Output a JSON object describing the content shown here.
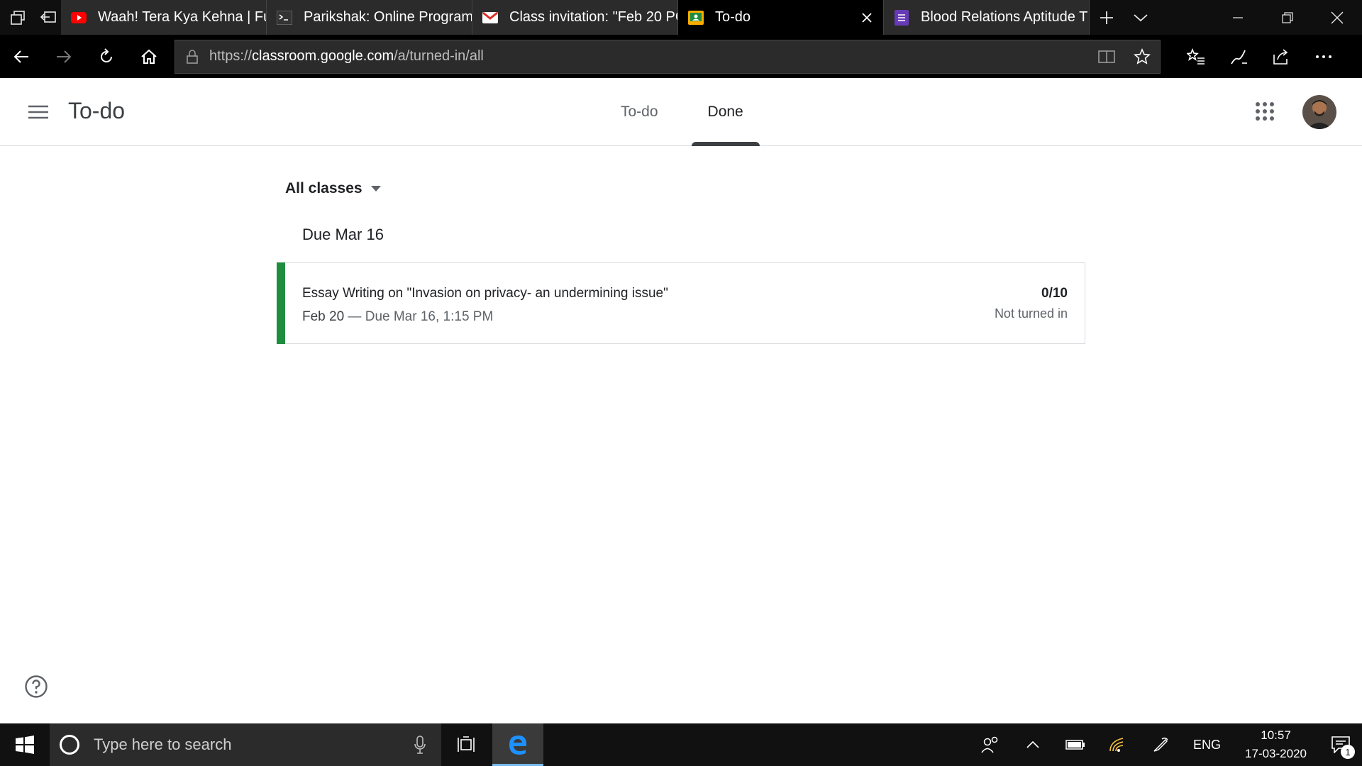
{
  "browser": {
    "tabs": [
      {
        "title": "Waah! Tera Kya Kehna | Fu",
        "icon": "youtube-icon",
        "active": false
      },
      {
        "title": "Parikshak: Online Program",
        "icon": "terminal-icon",
        "active": false
      },
      {
        "title": "Class invitation: \"Feb 20 PC",
        "icon": "gmail-icon",
        "active": false
      },
      {
        "title": "To-do",
        "icon": "classroom-icon",
        "active": true
      },
      {
        "title": "Blood Relations Aptitude T",
        "icon": "forms-icon",
        "active": false
      }
    ],
    "url": {
      "scheme": "https://",
      "host": "classroom.google.com",
      "path": "/a/turned-in/all"
    }
  },
  "header": {
    "title": "To-do",
    "tabs": [
      {
        "label": "To-do",
        "active": false
      },
      {
        "label": "Done",
        "active": true
      }
    ]
  },
  "content": {
    "class_filter": "All classes",
    "groups": [
      {
        "heading": "Due Mar 16",
        "assignments": [
          {
            "title": "Essay Writing on \"Invasion on privacy- an undermining issue\"",
            "posted": "Feb 20",
            "separator": " — ",
            "due": "Due Mar 16, 1:15 PM",
            "grade": "0/10",
            "status": "Not turned in",
            "accent_color": "#1e8e3e"
          }
        ]
      }
    ]
  },
  "taskbar": {
    "search_placeholder": "Type here to search",
    "language": "ENG",
    "time": "10:57",
    "date": "17-03-2020",
    "notification_count": "1"
  }
}
